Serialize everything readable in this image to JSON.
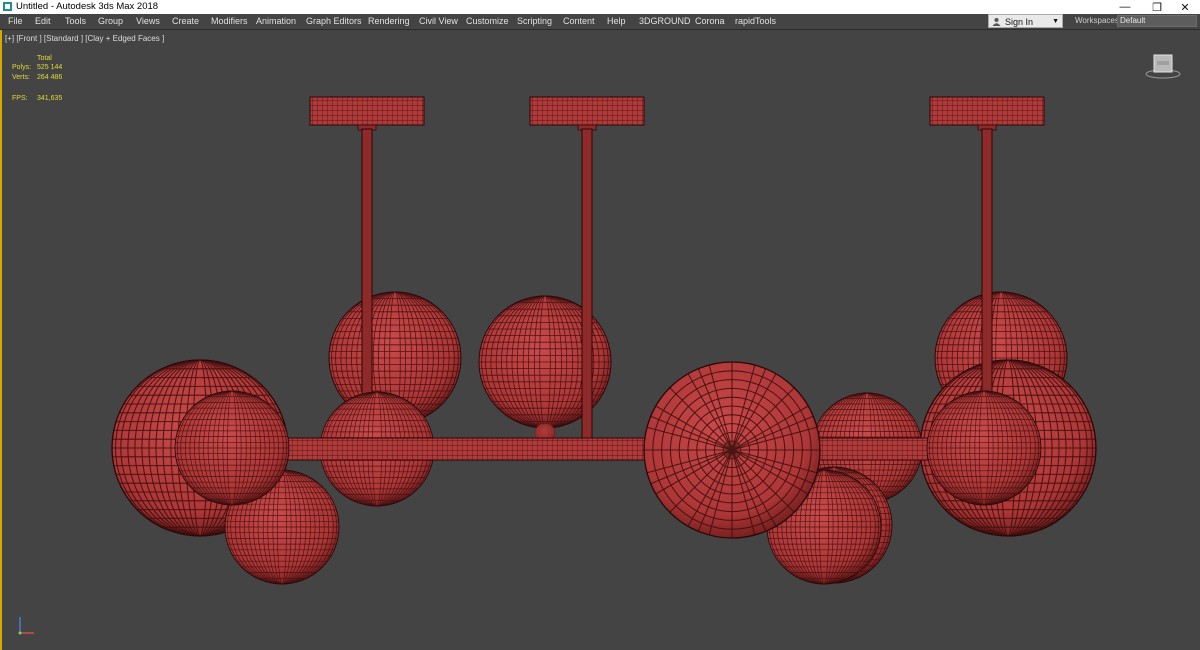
{
  "titlebar": {
    "title": "Untitled - Autodesk 3ds Max 2018",
    "minimize_glyph": "—",
    "restore_glyph": "❐",
    "close_glyph": "✕"
  },
  "menu": {
    "items": [
      "File",
      "Edit",
      "Tools",
      "Group",
      "Views",
      "Create",
      "Modifiers",
      "Animation",
      "Graph Editors",
      "Rendering",
      "Civil View",
      "Customize",
      "Scripting",
      "Content",
      "Help",
      "3DGROUND",
      "Corona",
      "rapidTools"
    ]
  },
  "signin": {
    "label": "Sign In"
  },
  "workspaces": {
    "label": "Workspaces:",
    "value": "Default"
  },
  "viewport": {
    "label": "[+] [Front ] [Standard ] [Clay + Edged Faces ]",
    "stats": {
      "total_header": "Total",
      "polys_label": "Polys:",
      "polys_value": "525 144",
      "verts_label": "Verts:",
      "verts_value": "264 486",
      "fps_label": "FPS:",
      "fps_value": "341,635"
    }
  },
  "colors": {
    "viewport_bg": "#444444",
    "model_fill": "#b73e3e",
    "wire": "#3a0d0d",
    "active_border": "#d6a800",
    "stats_text": "#e0dc36"
  },
  "icons": [
    "app-icon",
    "user-icon",
    "dropdown-caret-icon",
    "viewcube-icon",
    "axis-tripod-icon"
  ]
}
